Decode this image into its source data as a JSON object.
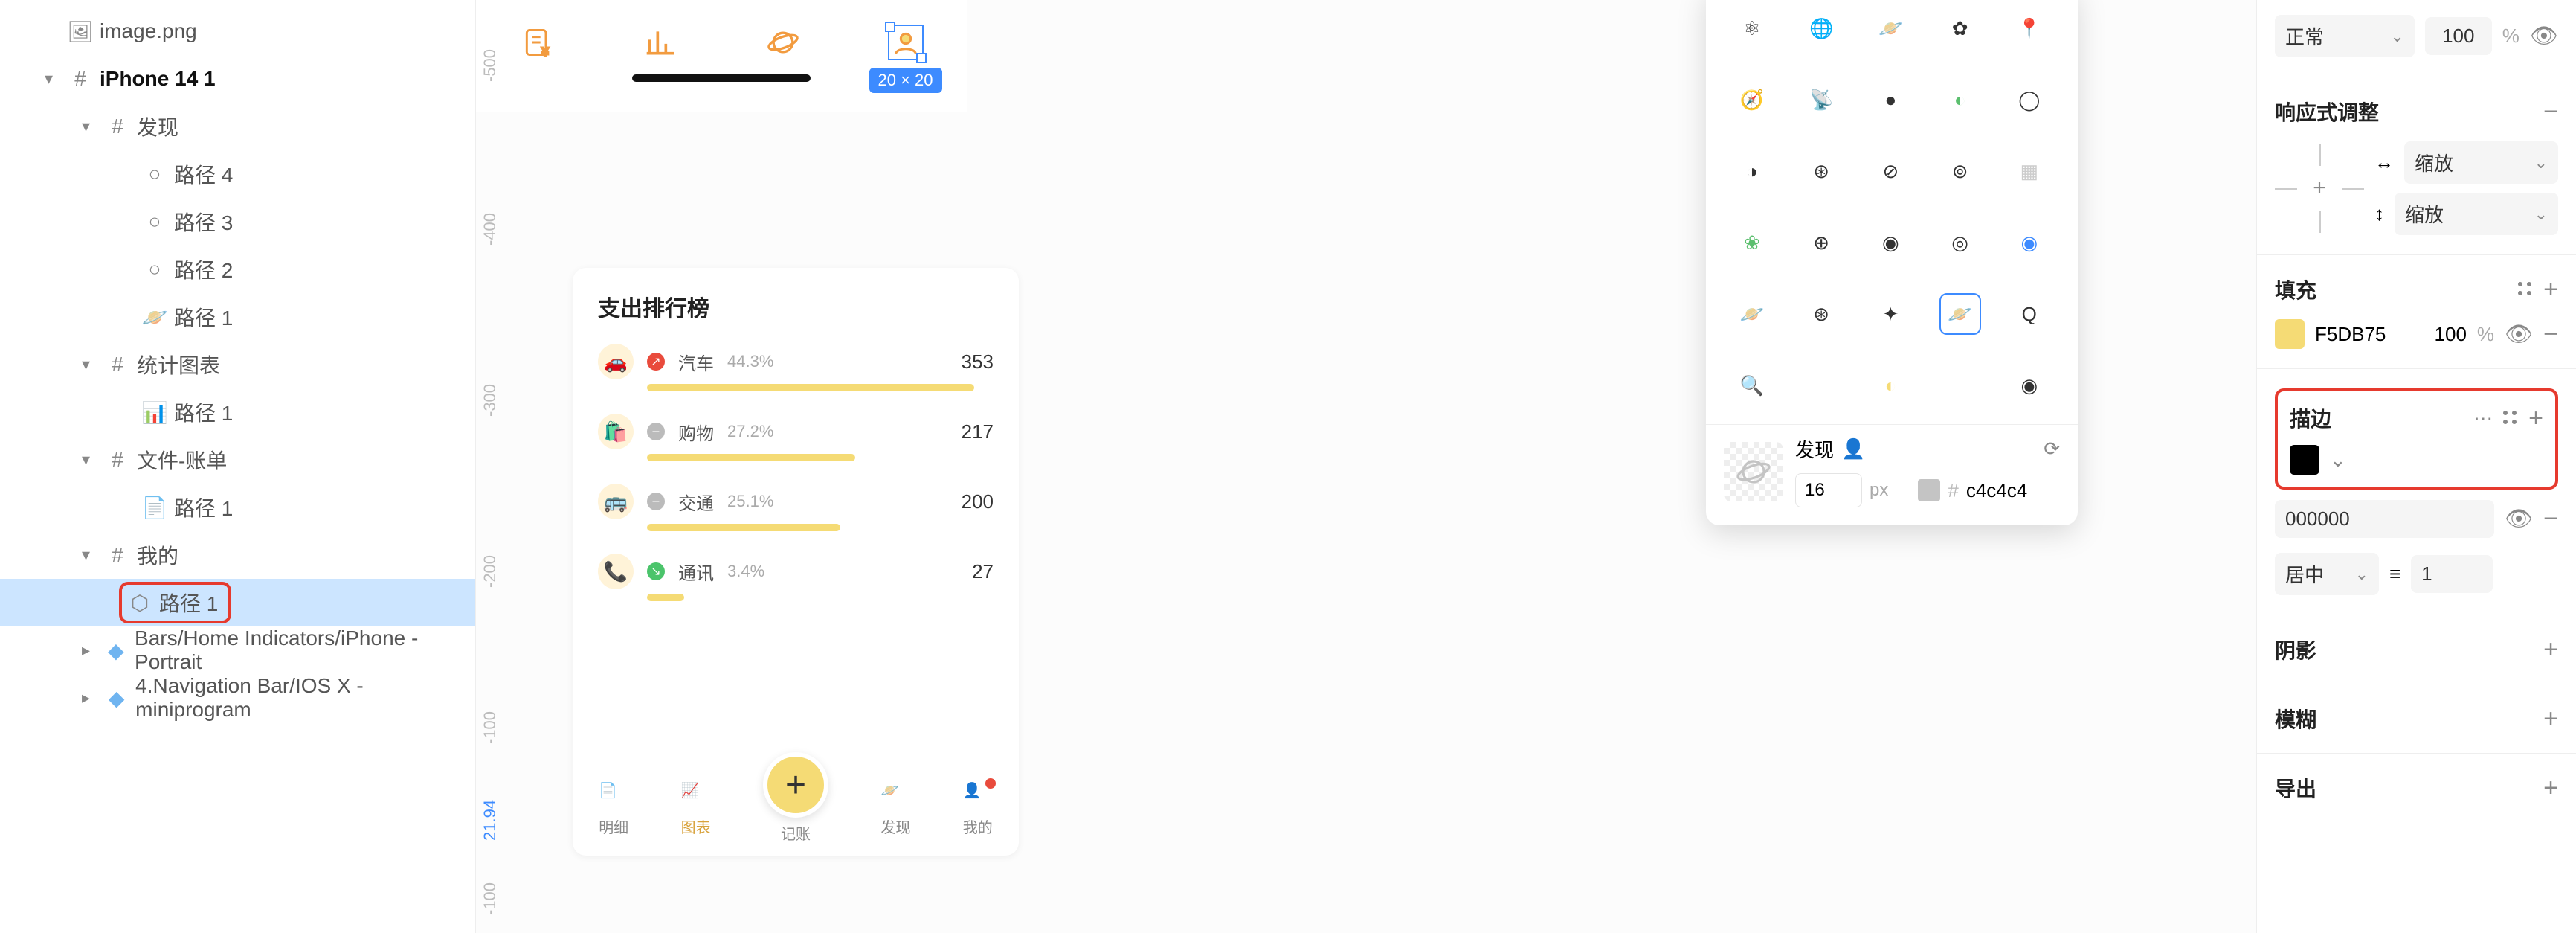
{
  "layers": {
    "image": "image.png",
    "frame": "iPhone 14 1",
    "discover": "发现",
    "path4": "路径 4",
    "path3": "路径 3",
    "path2": "路径 2",
    "path1": "路径 1",
    "stats": "统计图表",
    "stats_path1": "路径 1",
    "files": "文件-账单",
    "files_path1": "路径 1",
    "mine": "我的",
    "mine_path1": "路径 1",
    "bars": "Bars/Home Indicators/iPhone - Portrait",
    "nav": "4.Navigation Bar/IOS X - miniprogram"
  },
  "ruler": {
    "n500": "-500",
    "n400": "-400",
    "n300": "-300",
    "n200": "-200",
    "n100": "-100",
    "mark": "21.94",
    "n100b": "-100"
  },
  "phone1": {
    "title": "支出排行榜",
    "rows": [
      {
        "name": "汽车",
        "pct": "44.3%",
        "val": "353",
        "bar": 440,
        "trend": "up",
        "emoji": "🚗"
      },
      {
        "name": "购物",
        "pct": "27.2%",
        "val": "217",
        "bar": 280,
        "trend": "zero",
        "emoji": "🛍️"
      },
      {
        "name": "交通",
        "pct": "25.1%",
        "val": "200",
        "bar": 260,
        "trend": "zero",
        "emoji": "🚌"
      },
      {
        "name": "通讯",
        "pct": "3.4%",
        "val": "27",
        "bar": 50,
        "trend": "down",
        "emoji": "📞"
      }
    ],
    "tabs": {
      "t1": "明细",
      "t2": "图表",
      "t3": "记账",
      "t4": "发现",
      "t5": "我的"
    }
  },
  "selection_badge": "20 × 20",
  "popover": {
    "label": "发现",
    "size": "16",
    "size_unit": "px",
    "color": "c4c4c4"
  },
  "inspector": {
    "blend": "正常",
    "opacity": "100",
    "pct": "%",
    "responsive": "响应式调整",
    "scale_h": "缩放",
    "scale_v": "缩放",
    "fill": "填充",
    "fill_hex": "F5DB75",
    "fill_op": "100",
    "stroke": "描边",
    "stroke_hex": "000000",
    "stroke_align": "居中",
    "stroke_w": "1",
    "shadow": "阴影",
    "blur": "模糊",
    "export": "导出"
  }
}
